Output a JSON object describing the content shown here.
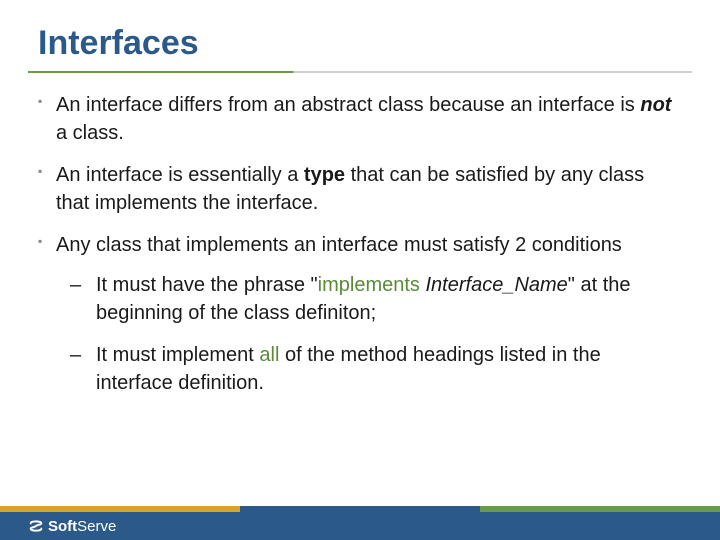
{
  "title": "Interfaces",
  "bullets": {
    "b1_pre": "An interface differs from an abstract class because an interface is ",
    "b1_em": "not",
    "b1_post": " a class.",
    "b2_pre": "An interface is essentially a ",
    "b2_bold": "type",
    "b2_post": " that can be satisfied by any class that implements the interface.",
    "b3": "Any class that implements an interface must satisfy 2 conditions",
    "s1_pre": "It must have the phrase \"",
    "s1_kw": "implements",
    "s1_space": " ",
    "s1_if": "Interface_Name",
    "s1_post": "\" at the beginning of the class definiton;",
    "s2_pre": "It must implement ",
    "s2_kw": "all",
    "s2_post": " of the method headings listed in the interface definition."
  },
  "footer": {
    "brand_prefix": "Soft",
    "brand_suffix": "Serve"
  }
}
